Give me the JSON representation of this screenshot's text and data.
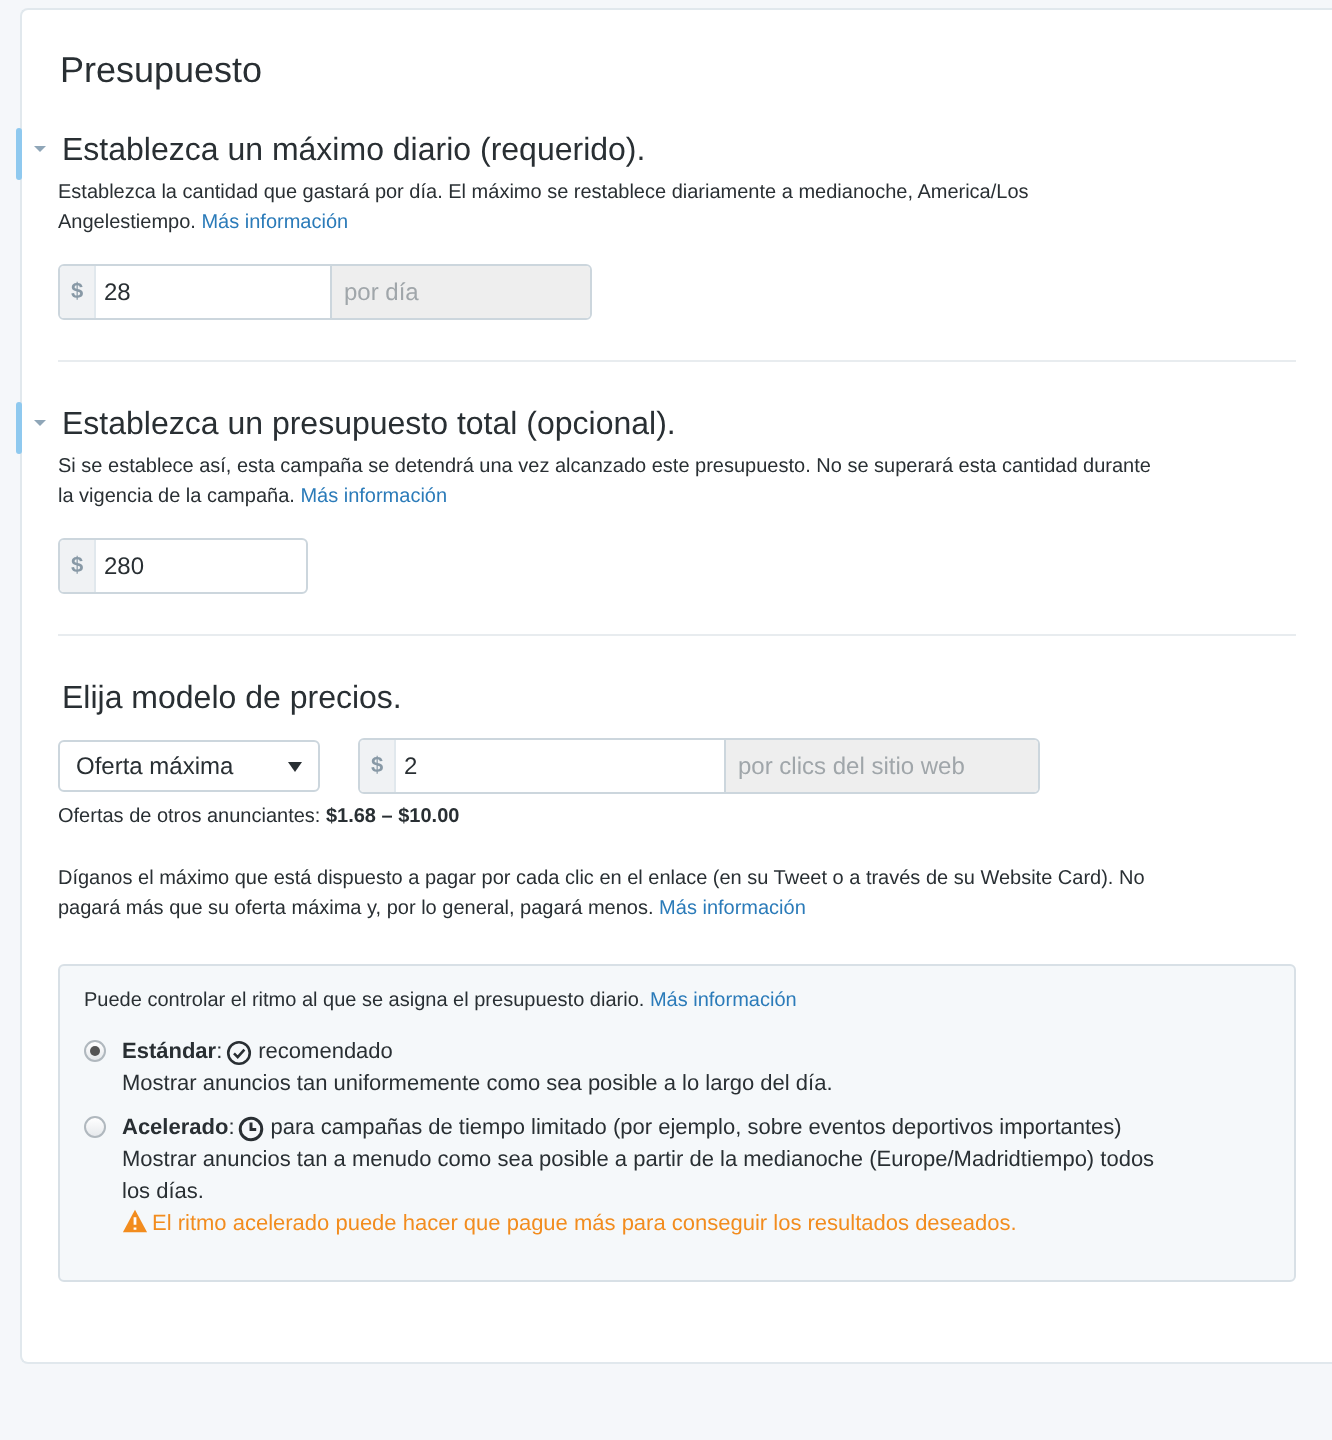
{
  "title": "Presupuesto",
  "sections": [
    {
      "heading": "Establezca un máximo diario (requerido).",
      "description": "Establezca la cantidad que gastará por día. El máximo se restablece diariamente a medianoche, America/Los Angelestiempo.",
      "link": "Más información",
      "field": {
        "prefix": "$",
        "value": "28",
        "suffix": "por día"
      }
    },
    {
      "heading": "Establezca un presupuesto total (opcional).",
      "description": "Si se establece así, esta campaña se detendrá una vez alcanzado este presupuesto. No se superará esta cantidad durante la vigencia de la campaña.",
      "link": "Más información",
      "field": {
        "prefix": "$",
        "value": "280"
      }
    }
  ],
  "pricing": {
    "heading": "Elija modelo de precios.",
    "select": "Oferta máxima",
    "field": {
      "prefix": "$",
      "value": "2",
      "suffix": "por clics del sitio web"
    },
    "bids_label": "Ofertas de otros anunciantes:",
    "bids_range": "$1.68 – $10.00",
    "description": "Díganos el máximo que está dispuesto a pagar por cada clic en el enlace (en su Tweet o a través de su Website Card). No pagará más que su oferta máxima y, por lo general, pagará menos.",
    "link": "Más información"
  },
  "pacing": {
    "intro": "Puede controlar el ritmo al que se asigna el presupuesto diario.",
    "link": "Más información",
    "options": [
      {
        "label": "**Estándar**:",
        "kind": "check",
        "note": "recomendado",
        "description": "Mostrar anuncios tan uniformemente como sea posible a lo largo del día.",
        "selected": true
      },
      {
        "label": "**Acelerado**:",
        "kind": "clock",
        "note": "para campañas de tiempo limitado (por ejemplo, sobre eventos deportivos importantes)",
        "description": "Mostrar anuncios tan a menudo como sea posible a partir de la medianoche (Europe/Madridtiempo) todos los días.",
        "warning": "El ritmo acelerado puede hacer que pague más para conseguir los resultados deseados.",
        "selected": false
      }
    ]
  }
}
